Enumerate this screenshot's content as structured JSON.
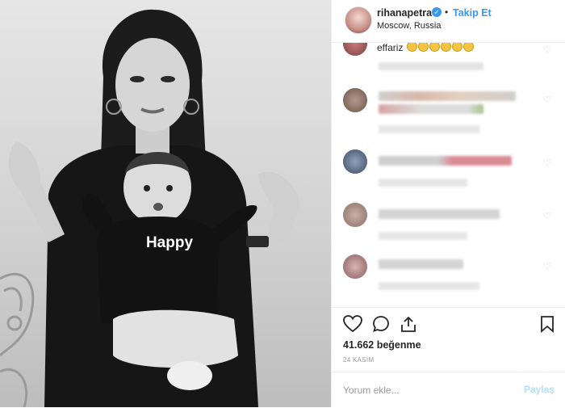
{
  "header": {
    "username": "rihanapetra",
    "verified_icon": "✓",
    "separator": "•",
    "follow_label": "Takip Et",
    "location": "Moscow, Russia",
    "more_icon": "•••"
  },
  "photo": {
    "shirt_text": "Happy"
  },
  "comments": {
    "first_partial_text": "effariz"
  },
  "footer": {
    "likes": "41.662 beğenme",
    "date": "24 KASIM",
    "comment_placeholder": "Yorum ekle...",
    "post_label": "Paylaş"
  },
  "colors": {
    "accent": "#3897f0",
    "post_disabled": "#b2dffc"
  }
}
